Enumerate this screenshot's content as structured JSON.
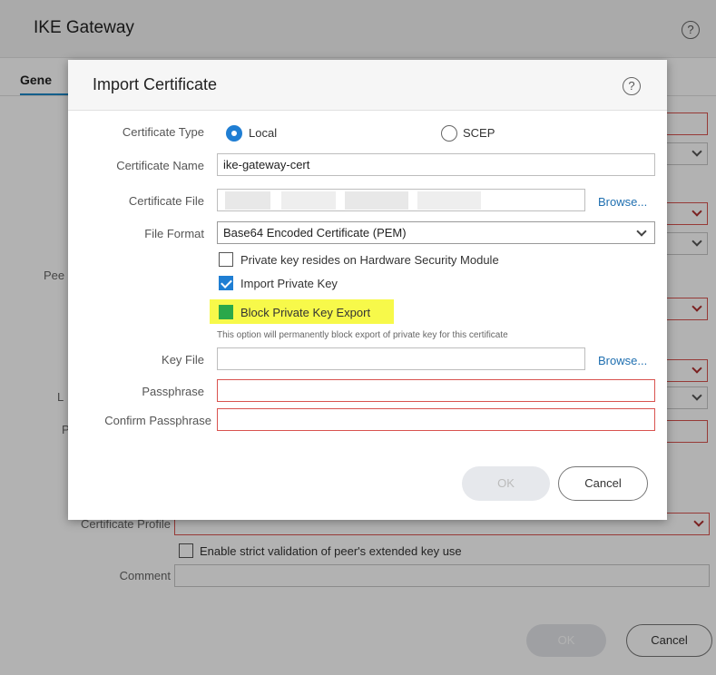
{
  "background": {
    "title": "IKE Gateway",
    "tab_general": "Gene",
    "label_peer": "Pee",
    "label_l": "L",
    "label_p": "P",
    "certificate_profile_label": "Certificate Profile",
    "strict_validation_label": "Enable strict validation of peer's extended key use",
    "comment_label": "Comment",
    "ok_label": "OK",
    "cancel_label": "Cancel"
  },
  "modal": {
    "title": "Import Certificate",
    "certificate_type_label": "Certificate Type",
    "radio_local": "Local",
    "radio_scep": "SCEP",
    "certificate_name_label": "Certificate Name",
    "certificate_name_value": "ike-gateway-cert",
    "certificate_file_label": "Certificate File",
    "browse_label": "Browse...",
    "file_format_label": "File Format",
    "file_format_value": "Base64 Encoded Certificate (PEM)",
    "hsm_label": "Private key resides on Hardware Security Module",
    "import_private_key_label": "Import Private Key",
    "block_export_label": "Block Private Key Export",
    "block_export_hint": "This option will permanently block export of private key for this certificate",
    "key_file_label": "Key File",
    "passphrase_label": "Passphrase",
    "confirm_passphrase_label": "Confirm Passphrase",
    "ok_label": "OK",
    "cancel_label": "Cancel"
  },
  "colors": {
    "accent": "#1f7ed3",
    "highlight": "#f7f94a",
    "error_border": "#d9534f",
    "checked_green": "#2aa84a"
  }
}
